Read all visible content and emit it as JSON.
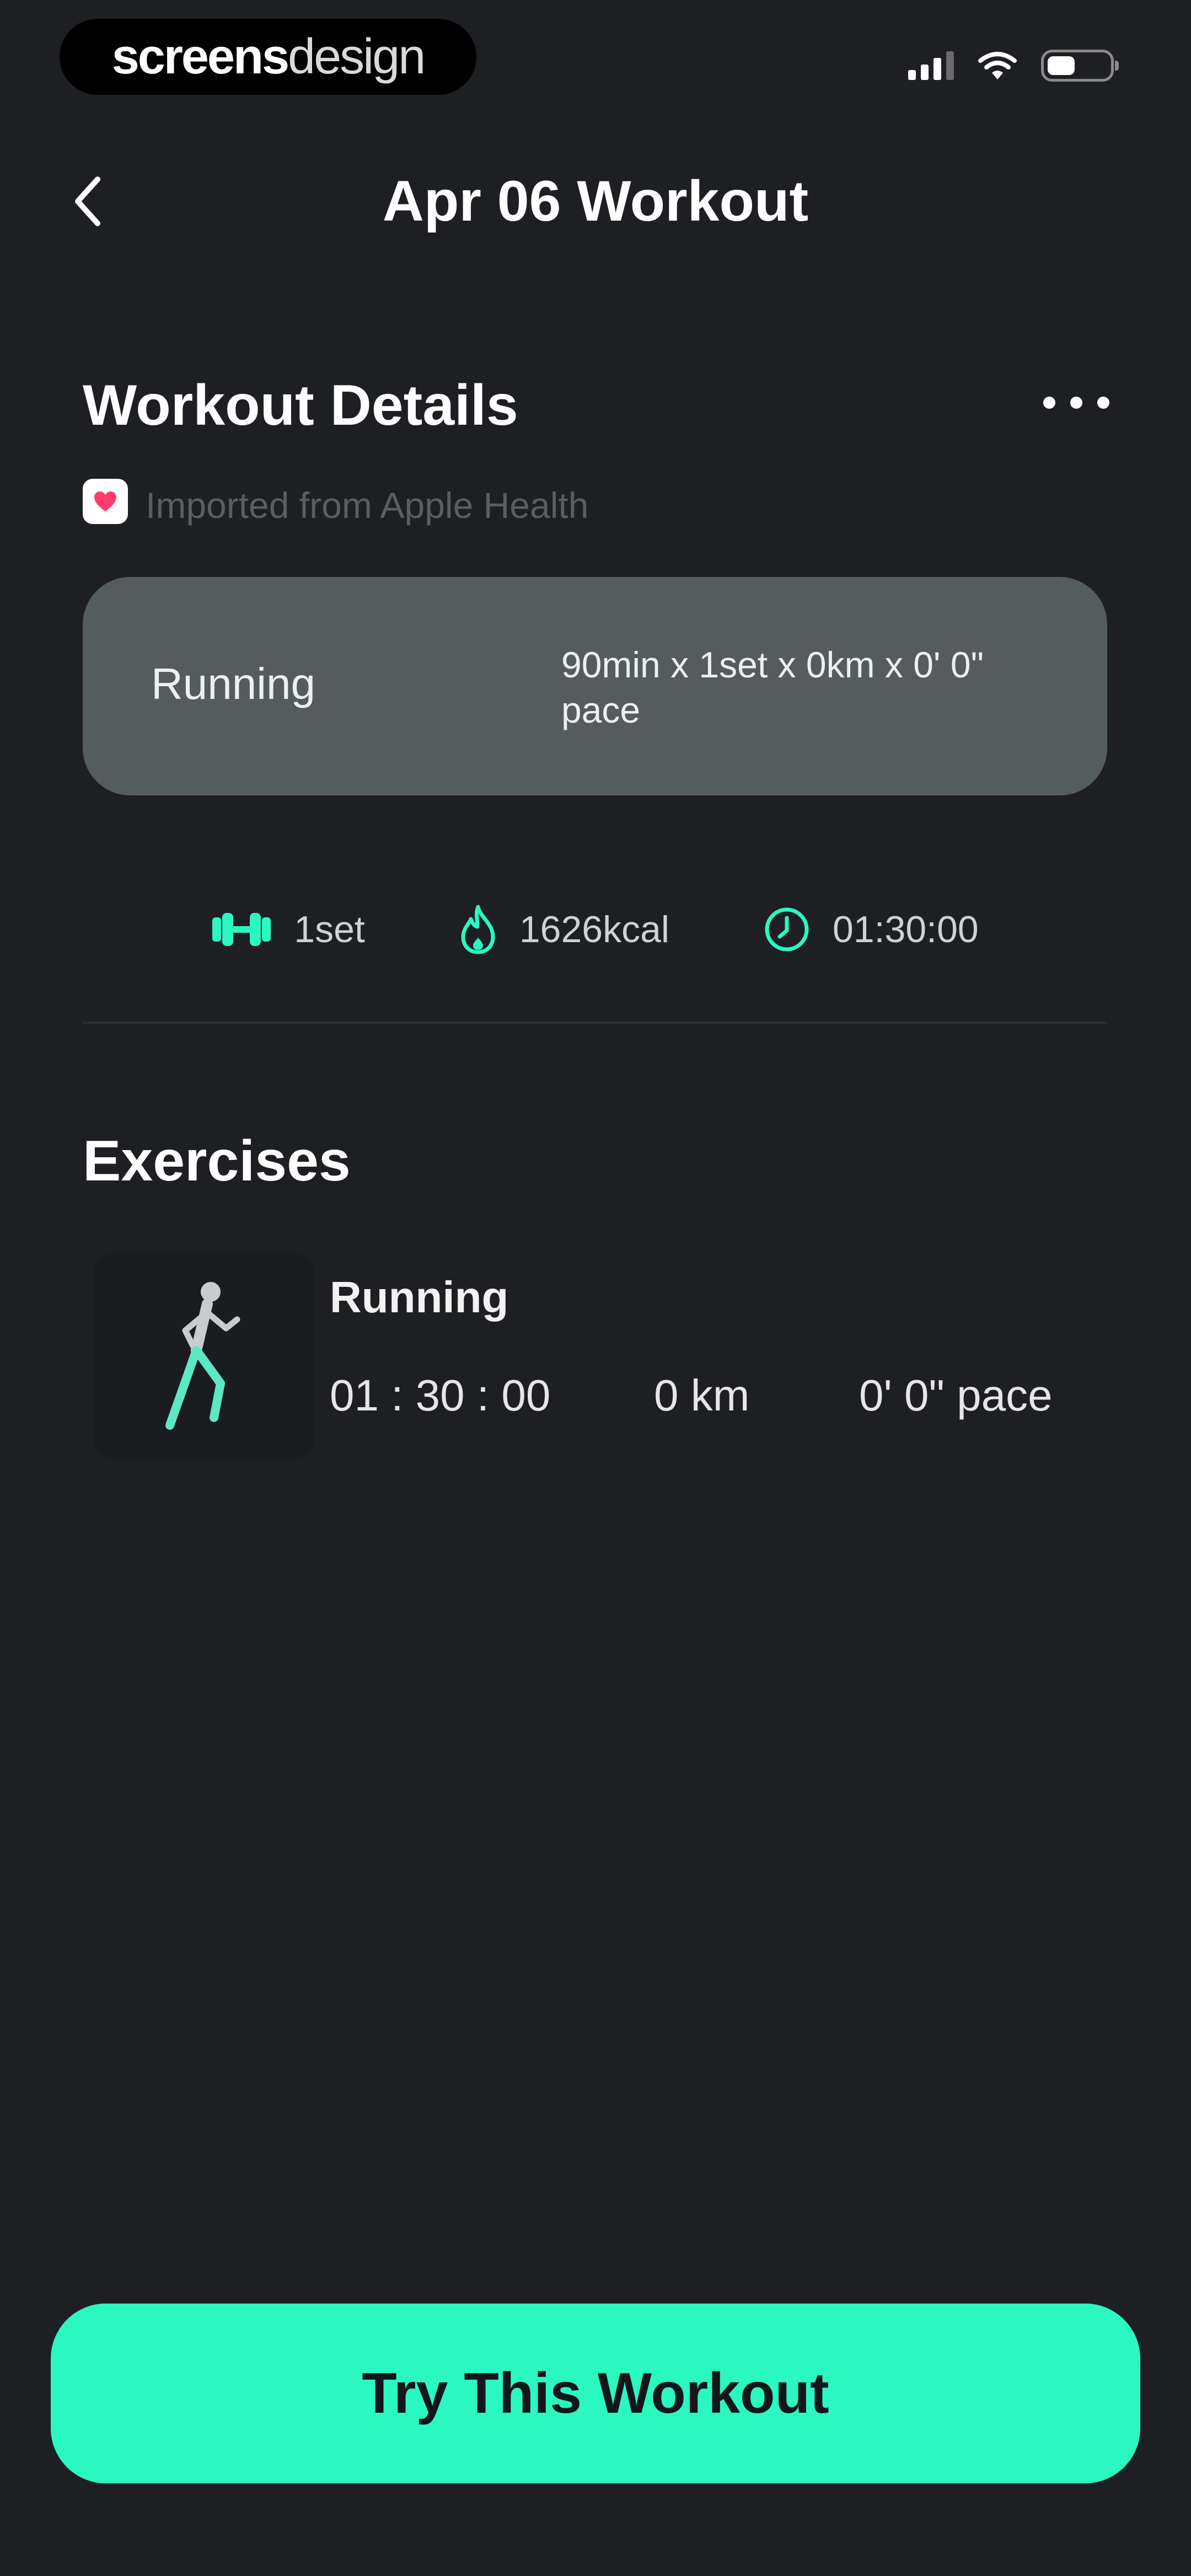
{
  "status_bar": {
    "brand_primary": "screens",
    "brand_secondary": "design"
  },
  "header": {
    "title": "Apr 06 Workout",
    "back_icon": "chevron-left-icon"
  },
  "details": {
    "title": "Workout Details",
    "more_icon": "more-dots-icon",
    "source_text": "Imported from Apple Health",
    "card": {
      "name": "Running",
      "description": "90min x 1set x 0km x 0' 0\" pace"
    },
    "stats": {
      "sets": "1set",
      "calories": "1626kcal",
      "duration": "01:30:00"
    }
  },
  "exercises": {
    "title": "Exercises",
    "items": [
      {
        "name": "Running",
        "time": "01 : 30 : 00",
        "distance": "0 km",
        "pace": "0' 0\" pace"
      }
    ]
  },
  "cta": {
    "label": "Try This Workout"
  },
  "colors": {
    "accent": "#2af8c0",
    "background": "#1e1f23",
    "card": "#555c5e"
  }
}
